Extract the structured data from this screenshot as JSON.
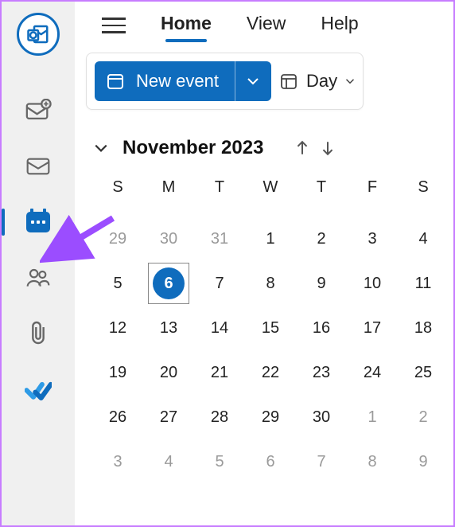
{
  "tabs": {
    "home": "Home",
    "view": "View",
    "help": "Help"
  },
  "toolbar": {
    "new_event": "New event",
    "day": "Day"
  },
  "month": {
    "title": "November 2023",
    "dow": [
      "S",
      "M",
      "T",
      "W",
      "T",
      "F",
      "S"
    ],
    "weeks": [
      [
        {
          "n": 29,
          "muted": true
        },
        {
          "n": 30,
          "muted": true
        },
        {
          "n": 31,
          "muted": true
        },
        {
          "n": 1
        },
        {
          "n": 2
        },
        {
          "n": 3
        },
        {
          "n": 4
        }
      ],
      [
        {
          "n": 5
        },
        {
          "n": 6,
          "today": true
        },
        {
          "n": 7
        },
        {
          "n": 8
        },
        {
          "n": 9
        },
        {
          "n": 10
        },
        {
          "n": 11
        }
      ],
      [
        {
          "n": 12
        },
        {
          "n": 13
        },
        {
          "n": 14
        },
        {
          "n": 15
        },
        {
          "n": 16
        },
        {
          "n": 17
        },
        {
          "n": 18
        }
      ],
      [
        {
          "n": 19
        },
        {
          "n": 20
        },
        {
          "n": 21
        },
        {
          "n": 22
        },
        {
          "n": 23
        },
        {
          "n": 24
        },
        {
          "n": 25
        }
      ],
      [
        {
          "n": 26
        },
        {
          "n": 27
        },
        {
          "n": 28
        },
        {
          "n": 29
        },
        {
          "n": 30
        },
        {
          "n": 1,
          "muted": true
        },
        {
          "n": 2,
          "muted": true
        }
      ],
      [
        {
          "n": 3,
          "muted": true
        },
        {
          "n": 4,
          "muted": true
        },
        {
          "n": 5,
          "muted": true
        },
        {
          "n": 6,
          "muted": true
        },
        {
          "n": 7,
          "muted": true
        },
        {
          "n": 8,
          "muted": true
        },
        {
          "n": 9,
          "muted": true
        }
      ]
    ]
  }
}
